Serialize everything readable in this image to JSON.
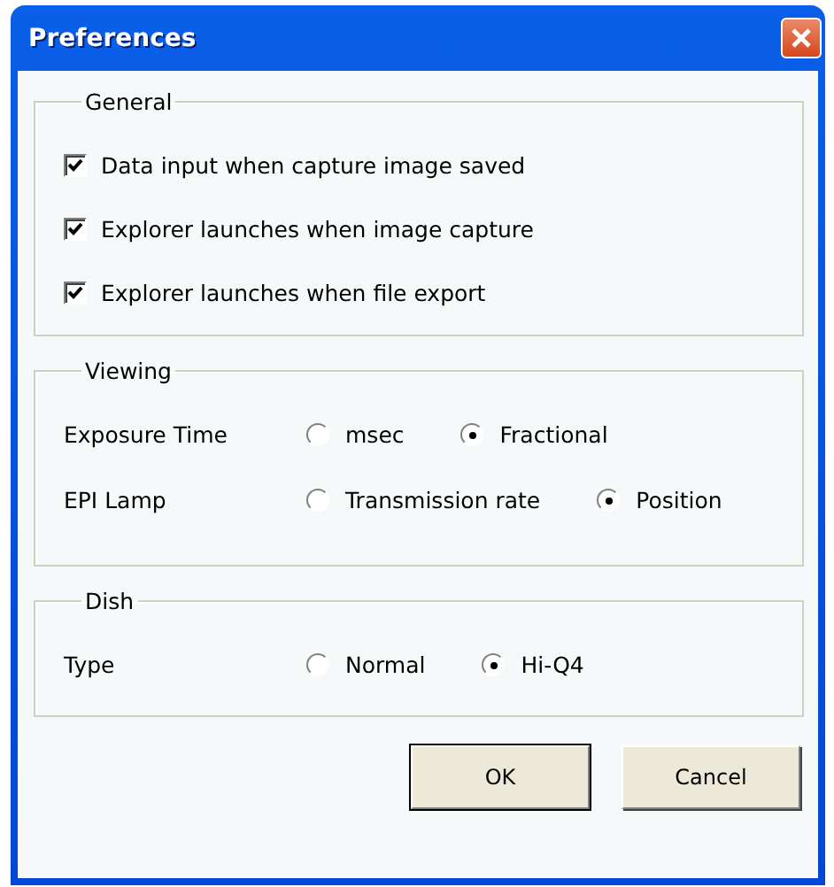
{
  "window": {
    "title": "Preferences"
  },
  "groups": [
    {
      "title": "General",
      "kind": "checks",
      "options": [
        {
          "label": "Data input when capture image saved",
          "checked": true
        },
        {
          "label": "Explorer launches when image capture",
          "checked": true
        },
        {
          "label": "Explorer launches when file export",
          "checked": true
        }
      ]
    },
    {
      "title": "Viewing",
      "kind": "radios",
      "rows": [
        {
          "label": "Exposure Time",
          "options": [
            {
              "label": "msec",
              "selected": false
            },
            {
              "label": "Fractional",
              "selected": true
            }
          ]
        },
        {
          "label": "EPI Lamp",
          "options": [
            {
              "label": "Transmission rate",
              "selected": false
            },
            {
              "label": "Position",
              "selected": true
            }
          ]
        }
      ]
    },
    {
      "title": "Dish",
      "kind": "radios",
      "rows": [
        {
          "label": "Type",
          "options": [
            {
              "label": "Normal",
              "selected": false
            },
            {
              "label": "Hi-Q4",
              "selected": true
            }
          ]
        }
      ]
    }
  ],
  "buttons": [
    {
      "label": "OK",
      "default": true
    },
    {
      "label": "Cancel",
      "default": false
    }
  ]
}
